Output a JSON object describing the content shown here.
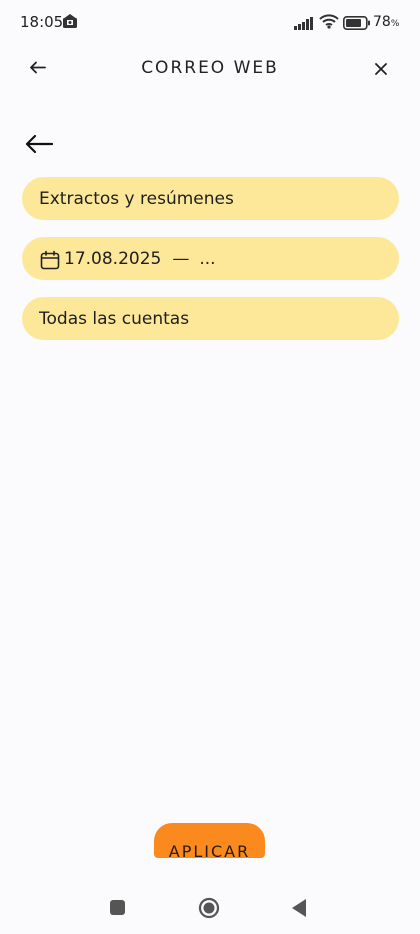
{
  "status_bar": {
    "time": "18:05",
    "battery_level": "78",
    "battery_unit": "%",
    "icons": [
      "notification-icon",
      "signal-icon",
      "wifi-icon",
      "battery-icon"
    ]
  },
  "header": {
    "title": "CORREO WEB",
    "back_icon": "arrow-left-icon",
    "close_icon": "close-icon"
  },
  "content": {
    "back_icon": "arrow-left-icon"
  },
  "filters": {
    "document_type": "Extractos y resúmenes",
    "date_from": "17.08.2025",
    "date_separator": "—",
    "date_to": "...",
    "accounts": "Todas las cuentas"
  },
  "apply_button": {
    "label": "APLICAR"
  },
  "colors": {
    "pill_background": "#fde89a",
    "accent": "#fa8a1d",
    "page_background": "#fbfbfd"
  },
  "nav_bar": {
    "icons": [
      "recent-apps-icon",
      "home-icon",
      "nav-back-icon"
    ]
  }
}
